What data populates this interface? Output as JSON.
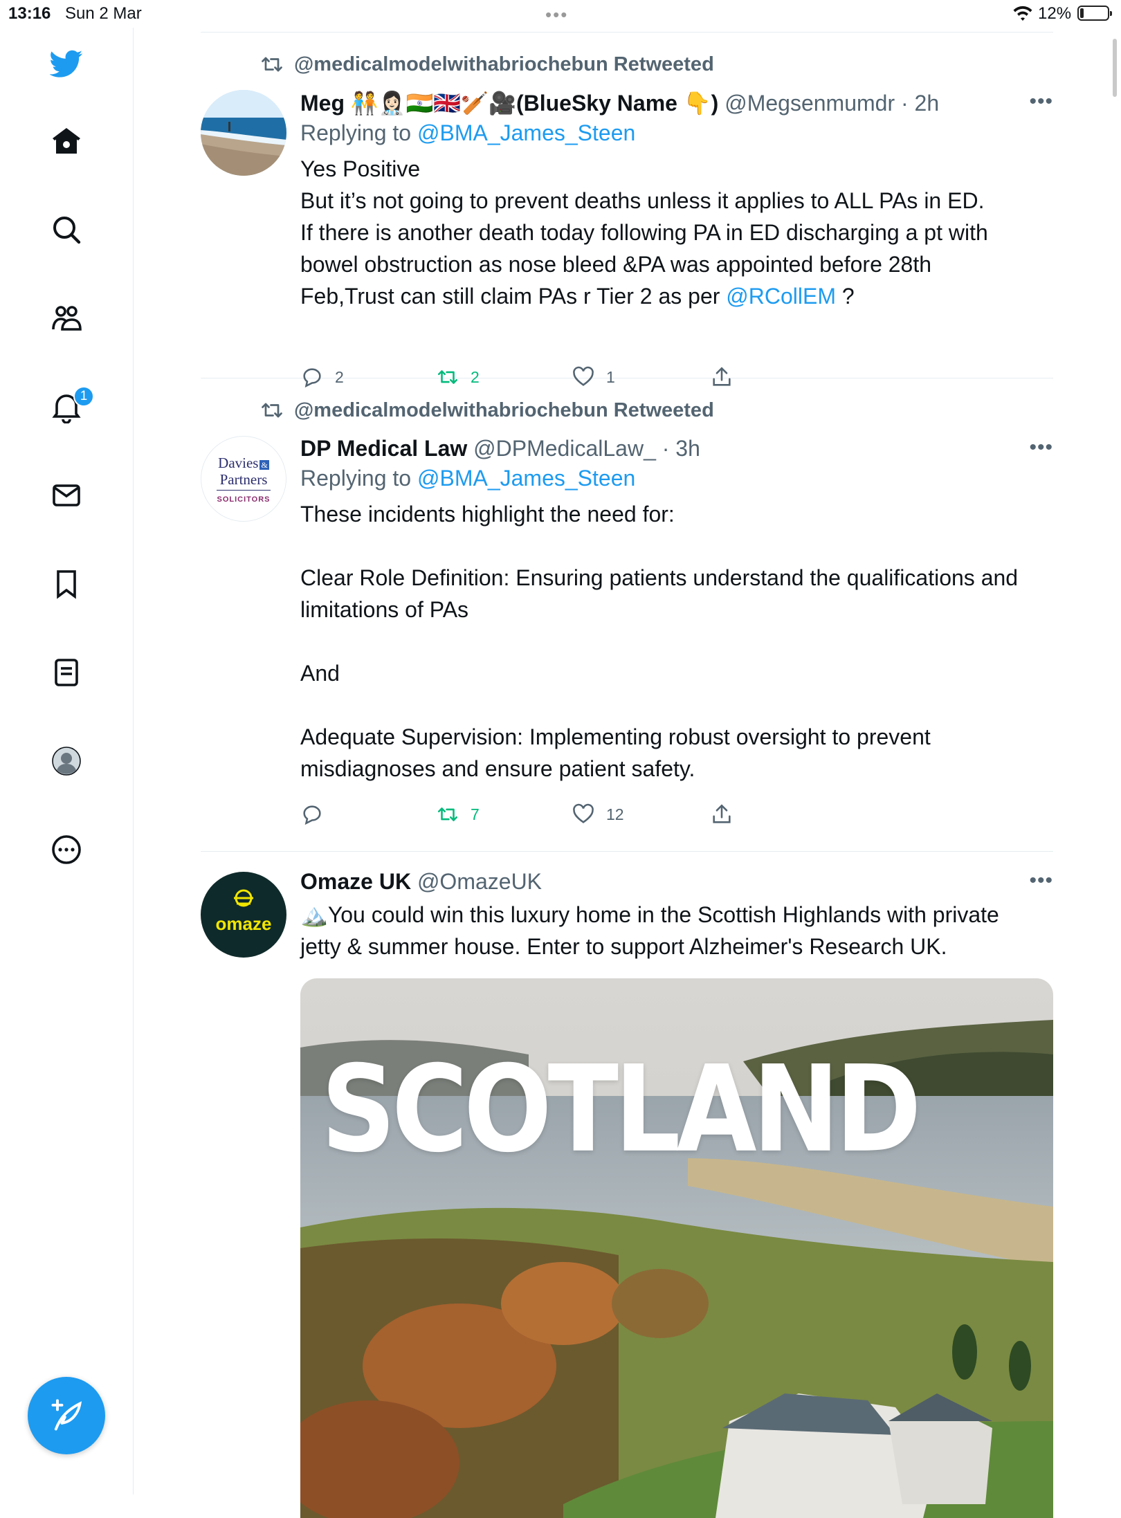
{
  "status_bar": {
    "time": "13:16",
    "date": "Sun 2 Mar",
    "battery": "12%",
    "dots": "•••"
  },
  "sidebar": {
    "items": [
      "twitter-logo",
      "home",
      "search",
      "communities",
      "notifications",
      "messages",
      "bookmarks",
      "lists",
      "profile",
      "more"
    ],
    "notification_count": "1"
  },
  "tweets": [
    {
      "retweeted_by": "@medicalmodelwithabriochebun Retweeted",
      "name": "Meg 🧑‍🤝‍🧑👩🏻‍⚕️🇮🇳🇬🇧🏏🎥(BlueSky Name 👇)",
      "handle": "@Megsenmumdr · 2h",
      "replying_prefix": "Replying to ",
      "replying_to": "@BMA_James_Steen",
      "text_lines": [
        "Yes Positive",
        "But it’s not going to prevent deaths unless it applies to ALL PAs in ED.",
        "If there is another death today following PA in ED discharging a pt with",
        "bowel obstruction as nose bleed &PA was appointed before 28th",
        "Feb,Trust can still claim PAs r Tier 2 as per "
      ],
      "mention": "@RCollEM",
      "mention_suffix": " ?",
      "replies": "2",
      "retweets": "2",
      "likes": "1",
      "more": "•••"
    },
    {
      "retweeted_by": "@medicalmodelwithabriochebun Retweeted",
      "name": "DP Medical Law",
      "handle": "@DPMedicalLaw_ · 3h",
      "replying_prefix": "Replying to ",
      "replying_to": "@BMA_James_Steen",
      "avatar_text": {
        "line1": "Davies",
        "amp": "&",
        "line2": "Partners",
        "line3": "SOLICITORS"
      },
      "p1": "These incidents highlight the need for:",
      "p2": "Clear Role Definition: Ensuring patients understand the qualifications and limitations of PAs",
      "p3": "And",
      "p4": "Adequate Supervision: Implementing robust oversight to prevent misdiagnoses and ensure patient safety.",
      "replies": "",
      "retweets": "7",
      "likes": "12",
      "more": "•••"
    },
    {
      "name": "Omaze UK",
      "handle": "@OmazeUK",
      "avatar_text": "omaze",
      "text_emoji": "🏔️",
      "text_line1": "You could win this luxury home in the Scottish Highlands with private",
      "text_line2": "jetty & summer house. Enter to support Alzheimer's Research UK.",
      "media_title": "SCOTLAND",
      "more": "•••"
    }
  ],
  "colors": {
    "accent": "#1d9bf0",
    "retweet": "#00ba7c",
    "muted": "#536471",
    "omaze_bg": "#0f2a2a",
    "omaze_yellow": "#f2e600"
  }
}
